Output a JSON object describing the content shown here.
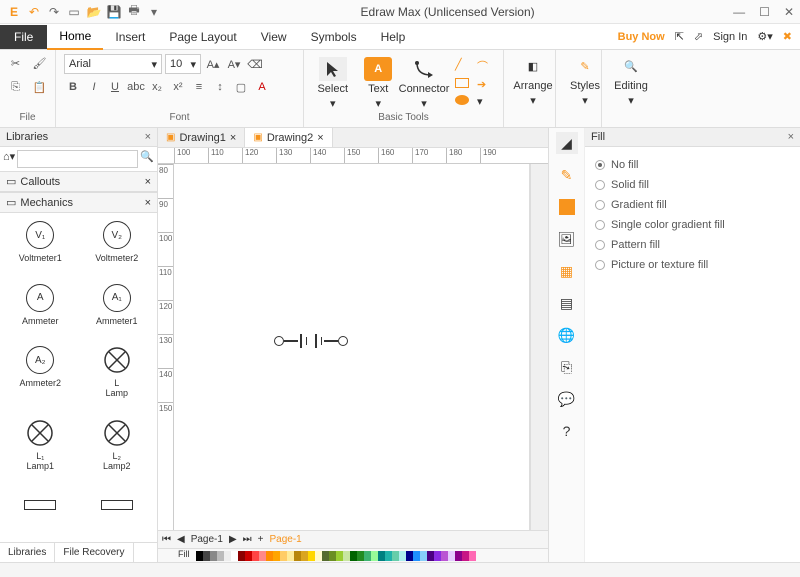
{
  "titlebar": {
    "title": "Edraw Max (Unlicensed Version)"
  },
  "menu": {
    "file": "File",
    "tabs": [
      "Home",
      "Insert",
      "Page Layout",
      "View",
      "Symbols",
      "Help"
    ],
    "active": 0,
    "buynow": "Buy Now",
    "signin": "Sign In"
  },
  "ribbon": {
    "file_label": "File",
    "font": {
      "label": "Font",
      "name": "Arial",
      "size": "10",
      "bold": "B",
      "italic": "I",
      "underline": "U"
    },
    "basic_tools": {
      "label": "Basic Tools",
      "select": "Select",
      "text": "Text",
      "connector": "Connector"
    },
    "arrange": "Arrange",
    "styles": "Styles",
    "editing": "Editing"
  },
  "left": {
    "libraries": "Libraries",
    "callouts": "Callouts",
    "mechanics": "Mechanics",
    "shapes": [
      {
        "sym": "V₁",
        "label": "Voltmeter1"
      },
      {
        "sym": "V₂",
        "label": "Voltmeter2"
      },
      {
        "sym": "A",
        "label": "Ammeter"
      },
      {
        "sym": "A₁",
        "label": "Ammeter1"
      },
      {
        "sym": "A₂",
        "label": "Ammeter2"
      },
      {
        "sym": "⊗",
        "label": "Lamp",
        "sub": "L"
      },
      {
        "sym": "⊗",
        "label": "Lamp1",
        "sub": "L₁"
      },
      {
        "sym": "⊗",
        "label": "Lamp2",
        "sub": "L₂"
      }
    ],
    "tabs": [
      "Libraries",
      "File Recovery"
    ]
  },
  "docs": {
    "tabs": [
      "Drawing1",
      "Drawing2"
    ],
    "active": 1
  },
  "ruler_h": [
    "100",
    "110",
    "120",
    "130",
    "140",
    "150",
    "160",
    "170",
    "180",
    "190"
  ],
  "ruler_v": [
    "80",
    "90",
    "100",
    "110",
    "120",
    "130",
    "140",
    "150"
  ],
  "pagebar": {
    "nav": "Page-1",
    "plus": "+",
    "active": "Page-1",
    "fill": "Fill"
  },
  "right": {
    "title": "Fill",
    "options": [
      "No fill",
      "Solid fill",
      "Gradient fill",
      "Single color gradient fill",
      "Pattern fill",
      "Picture or texture fill"
    ],
    "selected": 0
  },
  "colors": [
    "#000",
    "#444",
    "#888",
    "#bbb",
    "#eee",
    "#fff",
    "#8b0000",
    "#c00",
    "#f44",
    "#f88",
    "#ff8c00",
    "#ffa500",
    "#ffcc66",
    "#ffeb99",
    "#b8860b",
    "#daa520",
    "#ffd700",
    "#fffacd",
    "#556b2f",
    "#6b8e23",
    "#9acd32",
    "#c8e6a0",
    "#006400",
    "#228b22",
    "#3cb371",
    "#98fb98",
    "#008080",
    "#20b2aa",
    "#66cdaa",
    "#afeeee",
    "#00008b",
    "#1e90ff",
    "#87cefa",
    "#4b0082",
    "#8a2be2",
    "#ba55d3",
    "#e6ccff",
    "#8b008b",
    "#c71585",
    "#ff69b4"
  ]
}
